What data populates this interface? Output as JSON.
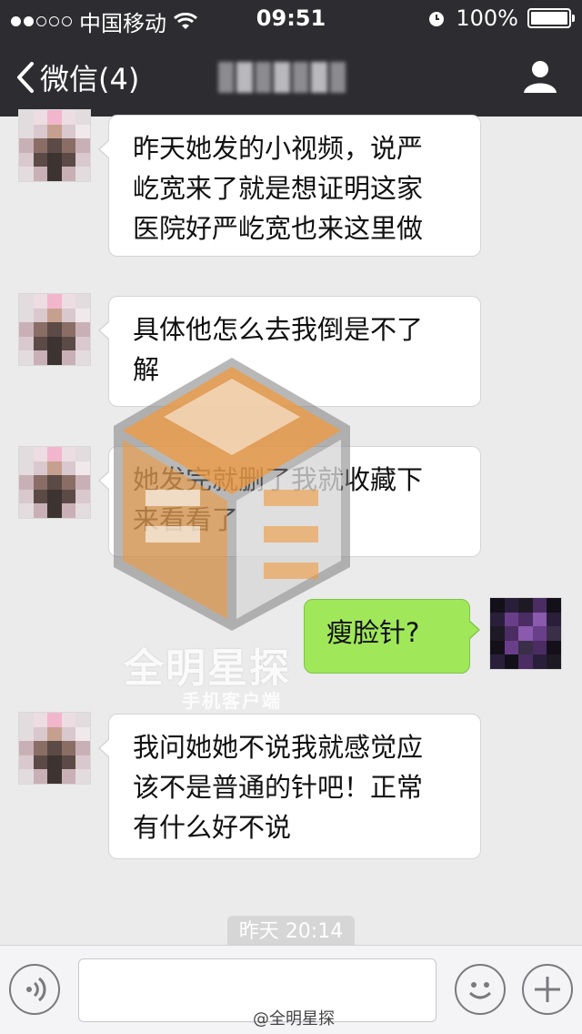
{
  "status_bar": {
    "carrier": "中国移动",
    "time": "09:51",
    "battery": "100%"
  },
  "nav": {
    "back_label": "微信(4)"
  },
  "messages": [
    {
      "side": "left",
      "text": "昨天她发的小视频，说严\n屹宽来了就是想证明这家\n医院好严屹宽也来这里做"
    },
    {
      "side": "left",
      "text": "具体他怎么去我倒是不了\n解"
    },
    {
      "side": "left",
      "text": "她发完就删了我就收藏下\n来看看了"
    },
    {
      "side": "right",
      "text": "瘦脸针?"
    },
    {
      "side": "left",
      "text": "我问她她不说我就感觉应\n该不是普通的针吧！正常\n有什么好不说"
    }
  ],
  "timestamp": "昨天 20:14",
  "watermark": {
    "title": "全明星探",
    "subtitle": "手机客户端"
  },
  "credit": "@全明星探",
  "colors": {
    "header": "#2d2d31",
    "chat_bg": "#ebebeb",
    "sent_bubble": "#a0e75a",
    "received_bubble": "#ffffff",
    "watermark_orange": "#f09a3e"
  }
}
